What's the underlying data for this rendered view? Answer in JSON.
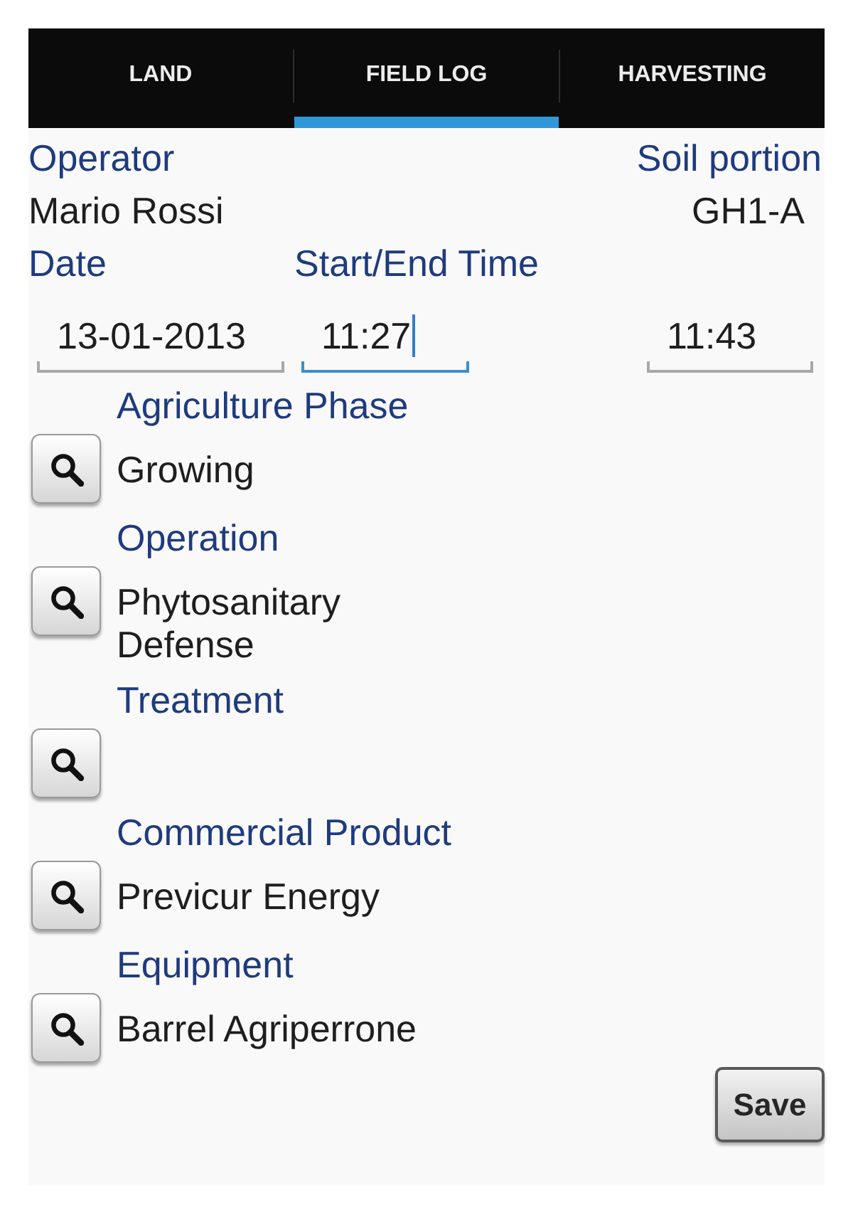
{
  "tabs": [
    {
      "label": "LAND",
      "selected": false
    },
    {
      "label": "FIELD LOG",
      "selected": true
    },
    {
      "label": "HARVESTING",
      "selected": false
    }
  ],
  "operator": {
    "label": "Operator",
    "value": "Mario Rossi"
  },
  "soil_portion": {
    "label": "Soil portion",
    "value": "GH1-A"
  },
  "date_field": {
    "label": "Date",
    "value": "13-01-2013",
    "focused": false
  },
  "time_fields": {
    "label": "Start/End Time",
    "start": {
      "value": "11:27",
      "focused": true
    },
    "end": {
      "value": "11:43",
      "focused": false
    }
  },
  "lookups": [
    {
      "label": "Agriculture Phase",
      "value": "Growing"
    },
    {
      "label": "Operation",
      "value": "Phytosanitary Defense"
    },
    {
      "label": "Treatment"
    },
    {
      "label": "Commercial Product",
      "value": "Previcur Energy"
    },
    {
      "label": "Equipment",
      "value": "Barrel Agriperrone"
    }
  ],
  "save_button": {
    "label": "Save"
  }
}
